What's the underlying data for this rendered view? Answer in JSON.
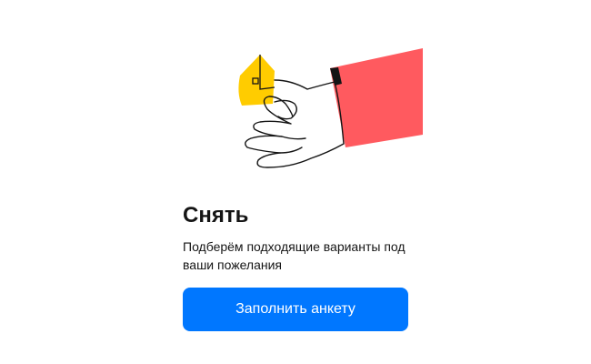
{
  "card": {
    "illustration_icon": "hand-holding-house-icon",
    "title": "Снять",
    "subtitle": "Подберём подходящие варианты под ваши пожелания",
    "button_label": "Заполнить анкету"
  },
  "colors": {
    "accent": "#0077ff",
    "sleeve": "#ff5a5f",
    "house": "#ffcc00",
    "text": "#151515",
    "background": "#ffffff"
  }
}
